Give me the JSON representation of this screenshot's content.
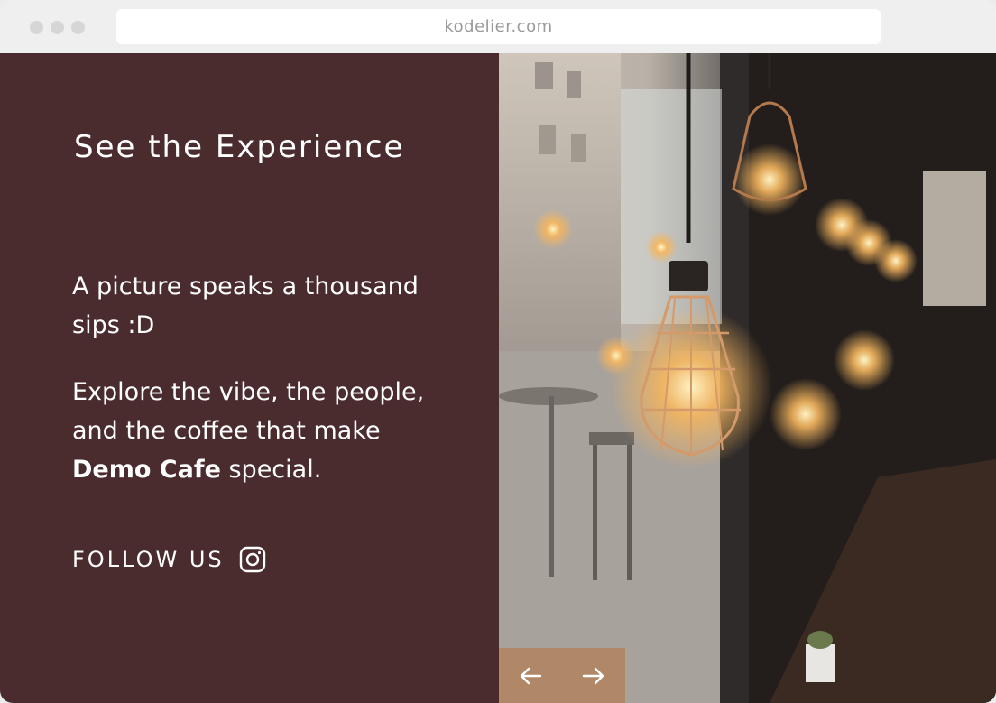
{
  "browser": {
    "url": "kodelier.com"
  },
  "hero": {
    "title": "See the Experience",
    "paragraph1": "A picture speaks a thousand sips :D",
    "paragraph2_prefix": "Explore the vibe, the people, and the coffee that make ",
    "paragraph2_brand": "Demo Cafe",
    "paragraph2_suffix": " special.",
    "follow_label": "FOLLOW US",
    "follow_icon": "instagram-icon"
  },
  "gallery": {
    "image": "cafe-hanging-lamps-photo",
    "prev_icon": "arrow-left-icon",
    "next_icon": "arrow-right-icon"
  },
  "colors": {
    "panel": "#4a2c2f",
    "nav": "#b08867",
    "text": "#ffffff"
  }
}
